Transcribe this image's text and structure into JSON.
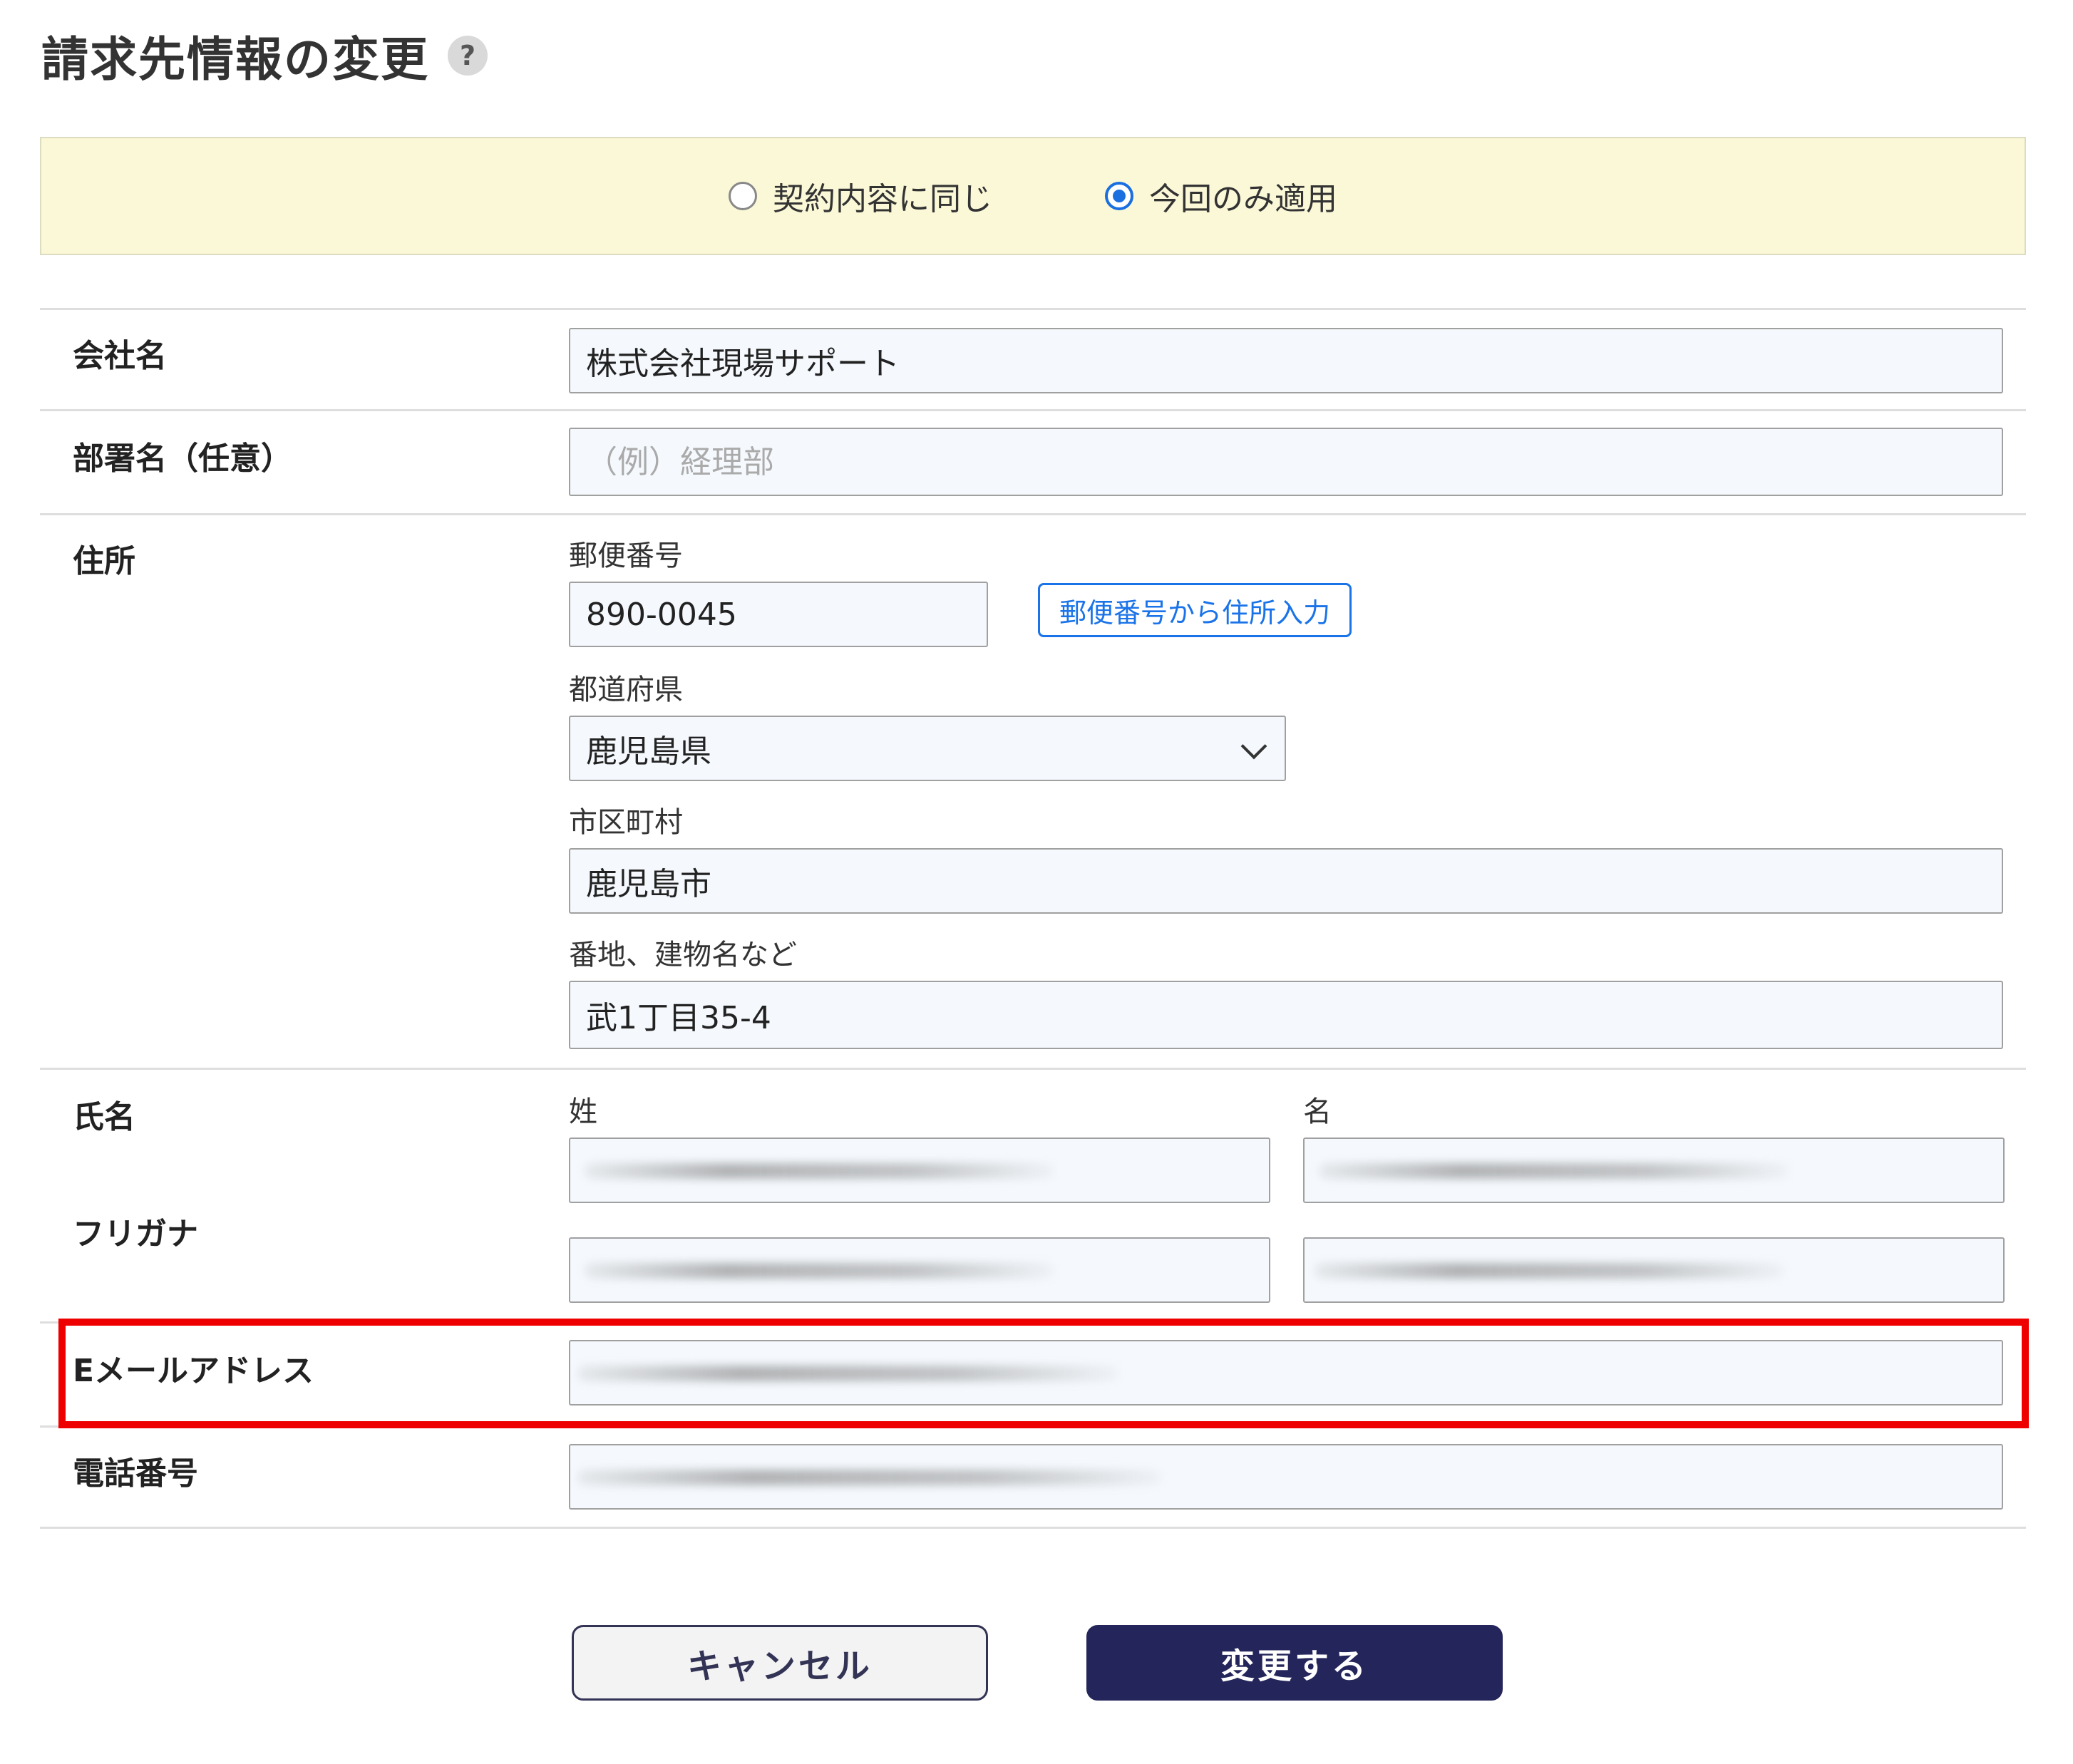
{
  "page": {
    "title": "請求先情報の変更",
    "help_icon": "question-icon"
  },
  "scope": {
    "options": [
      {
        "label": "契約内容に同じ",
        "checked": false
      },
      {
        "label": "今回のみ適用",
        "checked": true
      }
    ]
  },
  "form": {
    "company": {
      "label": "会社名",
      "value": "株式会社現場サポート"
    },
    "department": {
      "label": "部署名（任意）",
      "placeholder": "（例）経理部",
      "value": ""
    },
    "address": {
      "label": "住所",
      "zip_label": "郵便番号",
      "zip_value": "890-0045",
      "zip_button": "郵便番号から住所入力",
      "prefecture_label": "都道府県",
      "prefecture_value": "鹿児島県",
      "city_label": "市区町村",
      "city_value": "鹿児島市",
      "street_label": "番地、建物名など",
      "street_value": "武1丁目35-4"
    },
    "name": {
      "label": "氏名",
      "last_label": "姓",
      "first_label": "名"
    },
    "kana": {
      "label": "フリガナ"
    },
    "email": {
      "label": "Eメールアドレス"
    },
    "phone": {
      "label": "電話番号"
    }
  },
  "actions": {
    "cancel": "キャンセル",
    "submit": "変更する"
  },
  "colors": {
    "accent": "#1a73e8",
    "submit_bg": "#24255a",
    "band_bg": "#fbf8d8",
    "highlight": "#ee0000"
  }
}
